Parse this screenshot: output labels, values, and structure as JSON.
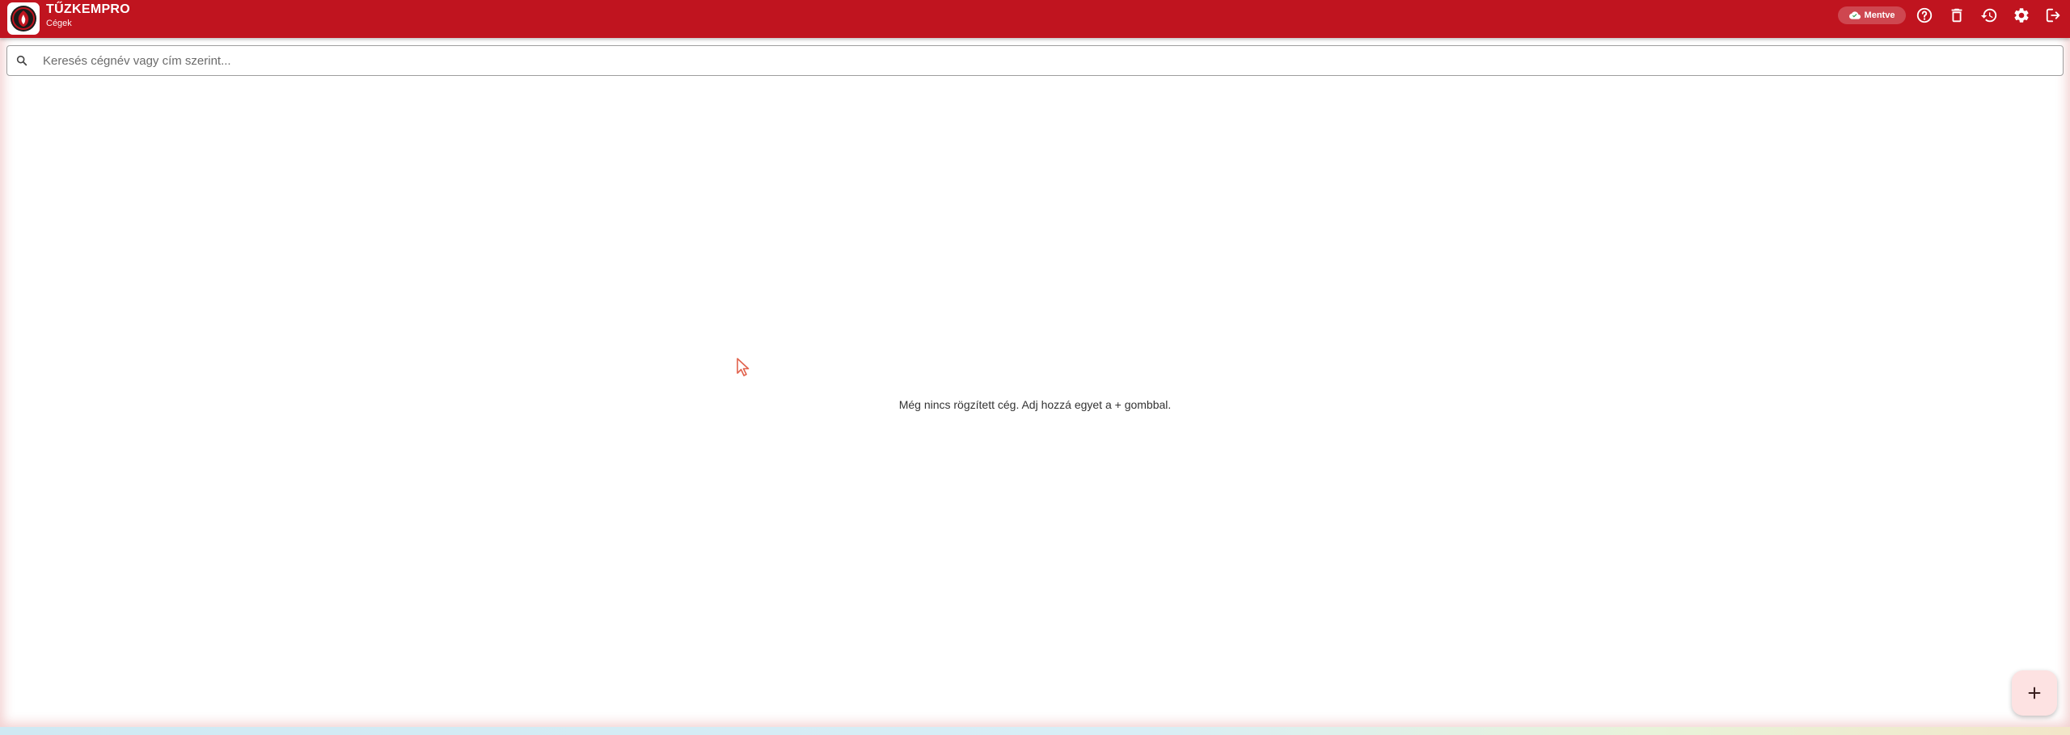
{
  "header": {
    "app_title": "TŰZKEMPRO",
    "subtitle": "Cégek",
    "status_chip": "Mentve",
    "accent_color": "#c0141f",
    "actions": [
      {
        "name": "help",
        "icon": "help-circle-icon"
      },
      {
        "name": "trash",
        "icon": "trash-icon"
      },
      {
        "name": "history",
        "icon": "history-icon"
      },
      {
        "name": "settings",
        "icon": "gear-icon"
      },
      {
        "name": "logout",
        "icon": "logout-icon"
      }
    ]
  },
  "search": {
    "placeholder": "Keresés cégnév vagy cím szerint...",
    "value": ""
  },
  "main": {
    "empty_message": "Még nincs rögzített cég. Adj hozzá egyet a + gombbal."
  },
  "fab": {
    "icon": "plus-icon",
    "background": "#fde2e2"
  }
}
